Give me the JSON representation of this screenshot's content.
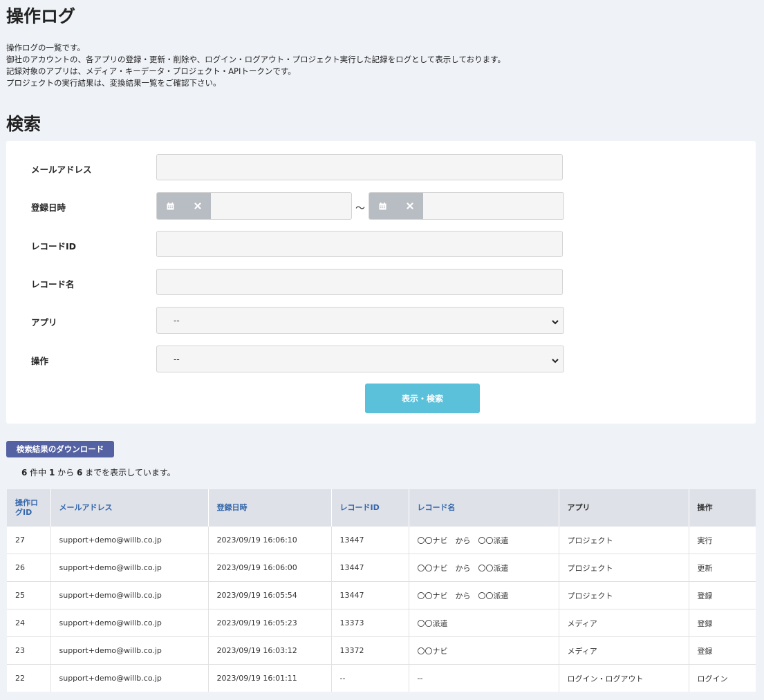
{
  "page": {
    "title": "操作ログ",
    "intro": [
      "操作ログの一覧です。",
      "御社のアカウントの、各アプリの登録・更新・削除や、ログイン・ログアウト・プロジェクト実行した記録をログとして表示しております。",
      "記録対象のアプリは、メディア・キーデータ・プロジェクト・APIトークンです。",
      "プロジェクトの実行結果は、変換結果一覧をご確認下さい。"
    ]
  },
  "search": {
    "title": "検索",
    "fields": {
      "email_label": "メールアドレス",
      "email_value": "",
      "date_label": "登録日時",
      "date_from": "",
      "date_to": "",
      "date_separator": "～",
      "record_id_label": "レコードID",
      "record_id_value": "",
      "record_name_label": "レコード名",
      "record_name_value": "",
      "app_label": "アプリ",
      "app_selected": "--",
      "operation_label": "操作",
      "operation_selected": "--"
    },
    "submit_label": "表示・検索"
  },
  "results": {
    "download_label": "検索結果のダウンロード",
    "count": {
      "total": "6",
      "from": "1",
      "to": "6",
      "t1": " 件中 ",
      "t2": " から ",
      "t3": " までを表示しています。"
    },
    "columns": [
      "操作ログID",
      "メールアドレス",
      "登録日時",
      "レコードID",
      "レコード名",
      "アプリ",
      "操作"
    ],
    "rows": [
      [
        "27",
        "support+demo@willb.co.jp",
        "2023/09/19 16:06:10",
        "13447",
        "〇〇ナビ　から　〇〇派遣",
        "プロジェクト",
        "実行"
      ],
      [
        "26",
        "support+demo@willb.co.jp",
        "2023/09/19 16:06:00",
        "13447",
        "〇〇ナビ　から　〇〇派遣",
        "プロジェクト",
        "更新"
      ],
      [
        "25",
        "support+demo@willb.co.jp",
        "2023/09/19 16:05:54",
        "13447",
        "〇〇ナビ　から　〇〇派遣",
        "プロジェクト",
        "登録"
      ],
      [
        "24",
        "support+demo@willb.co.jp",
        "2023/09/19 16:05:23",
        "13373",
        "〇〇派遣",
        "メディア",
        "登録"
      ],
      [
        "23",
        "support+demo@willb.co.jp",
        "2023/09/19 16:03:12",
        "13372",
        "〇〇ナビ",
        "メディア",
        "登録"
      ],
      [
        "22",
        "support+demo@willb.co.jp",
        "2023/09/19 16:01:11",
        "--",
        "--",
        "ログイン・ログアウト",
        "ログイン"
      ]
    ]
  },
  "icons": {
    "calendar": "calendar-icon",
    "clear": "close-icon",
    "select": "chevron-down-icon"
  },
  "colors": {
    "search_button": "#5bc0d9",
    "download_button": "#5461a2",
    "sort_header": "#3366aa"
  }
}
